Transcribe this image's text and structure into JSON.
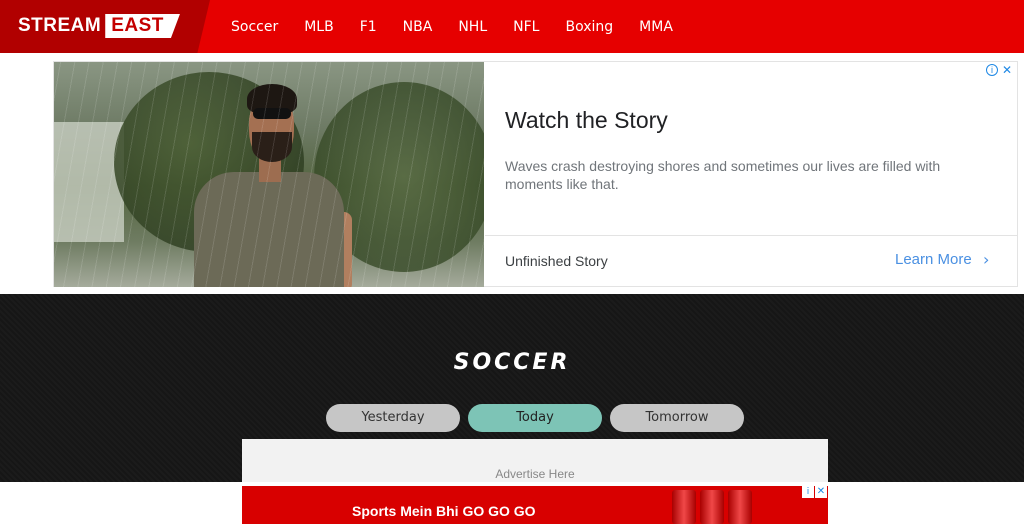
{
  "brand": {
    "prefix": "STREAM",
    "suffix": "EAST"
  },
  "nav": {
    "links": [
      "Soccer",
      "MLB",
      "F1",
      "NBA",
      "NHL",
      "NFL",
      "Boxing",
      "MMA"
    ]
  },
  "ad": {
    "title": "Watch the Story",
    "description": "Waves crash destroying shores and sometimes our lives are filled with moments like that.",
    "advertiser": "Unfinished Story",
    "cta": "Learn More",
    "cta_chevron": "›",
    "info_glyph": "i",
    "close_glyph": "✕"
  },
  "section": {
    "title": "SOCCER",
    "tabs": [
      "Yesterday",
      "Today",
      "Tomorrow"
    ],
    "active_tab": "Today",
    "advertise_label": "Advertise Here"
  },
  "banner": {
    "text": "Sports Mein Bhi GO GO GO",
    "info_glyph": "i",
    "close_glyph": "✕"
  },
  "colors": {
    "nav_red": "#e60000",
    "logo_red": "#b10000",
    "active_tab": "#7dc4b6",
    "link_blue": "#4a90e2"
  }
}
